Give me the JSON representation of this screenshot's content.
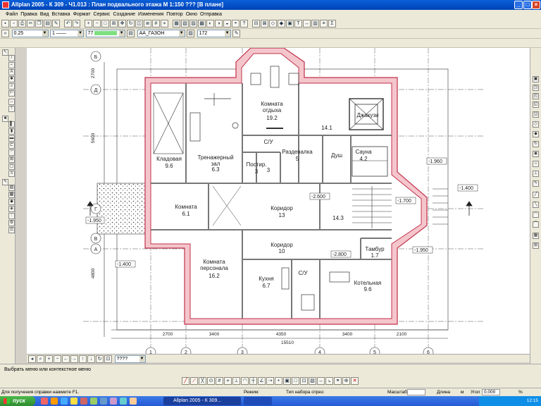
{
  "window": {
    "title": "Allplan 2005 - К 309 - Ч1.013 : План подвального этажа М 1:150          ???     [В плане]"
  },
  "menu": [
    "Файл",
    "Правка",
    "Вид",
    "Вставка",
    "Формат",
    "Сервис",
    "Создание",
    "Изменения",
    "Повтор",
    "Окно",
    "Отправка"
  ],
  "props": {
    "pen": "0.25",
    "line": "1",
    "color": "77",
    "layer": "AA_ГАЗОН",
    "hatch": "172"
  },
  "plan": {
    "rooms": [
      {
        "name": "Комната",
        "name2": "отдыха",
        "area": "19.2"
      },
      {
        "name": "Джакузи"
      },
      {
        "name": "14.1"
      },
      {
        "name": "С/У",
        "area": "3"
      },
      {
        "name": "Раздевалка",
        "area": "5"
      },
      {
        "name": "Душ"
      },
      {
        "name": "Сауна",
        "area": "4.2"
      },
      {
        "name": "Тренажерный",
        "name2": "зал",
        "area": "6.3"
      },
      {
        "name": "Кладовая",
        "area": "9.6"
      },
      {
        "name": "Постир.",
        "area": "3"
      },
      {
        "name": "Комната",
        "area": "6.1"
      },
      {
        "name": "Коридор",
        "area": "13"
      },
      {
        "name": "14.3"
      },
      {
        "name": "Коридор",
        "area": "10"
      },
      {
        "name": "Тамбур",
        "area": "1.7"
      },
      {
        "name": "Комната",
        "name2": "персонала",
        "area": "16.2"
      },
      {
        "name": "Кухня",
        "area": "6.7"
      },
      {
        "name": "С/У"
      },
      {
        "name": "Котельная",
        "area": "9.6"
      }
    ],
    "levels": [
      "-1.960",
      "-1.400",
      "-2.600",
      "-1.700",
      "-2.800",
      "-1.950",
      "-1.400",
      "-1.950",
      "-1.400"
    ],
    "dims_bottom": [
      "2700",
      "3400",
      "4350",
      "3400",
      "2100"
    ],
    "dim_total": "15510",
    "dims_left": [
      "2700",
      "5600",
      "4800"
    ],
    "axes_bottom": [
      "1",
      "2",
      "3",
      "4",
      "5",
      "6"
    ],
    "axes_left": [
      "Б",
      "Д",
      "Г",
      "В",
      "А"
    ]
  },
  "hscroll": {
    "scale": "????"
  },
  "prompt": "Выбрать меню или контекстное меню",
  "status": {
    "help": "Для получения справки нажмите F1.",
    "snap": "Режим:",
    "mode": "Тип набора отрез:",
    "scale_label": "Масштаб:",
    "length_label": "Длина",
    "length_unit": "м",
    "angle_label": "Угол",
    "angle": "0.000",
    "pct": "%"
  },
  "taskbar": {
    "start": "пуск",
    "task1": "Allplan 2005 - К 309...",
    "task2": "",
    "time": "12:15"
  },
  "colors": {
    "wall_fill": "#f4c6cc",
    "wall_line": "#c0304a",
    "titlebar": "#0a5fd8",
    "taskbar": "#2559d4"
  }
}
